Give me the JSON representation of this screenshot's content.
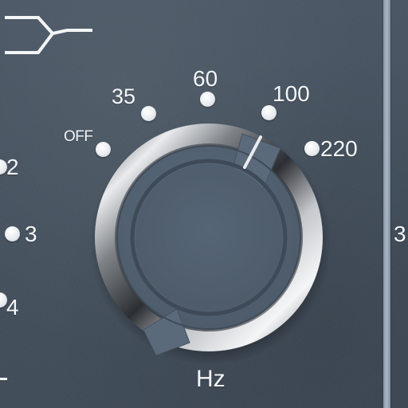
{
  "frequency_knob": {
    "unit_label": "Hz",
    "scale_labels": {
      "off": "OFF",
      "f35": "35",
      "f60": "60",
      "f100": "100",
      "f220": "220"
    },
    "selected_value": "100"
  },
  "left_selector": {
    "labels": [
      "2",
      "3",
      "4"
    ]
  },
  "right_edge_label": "3",
  "colors": {
    "panel_background": "#3e4b59",
    "marker_dots": "#eef0f2",
    "knob_cap": "#576778",
    "chrome_ring": "#b0b3b7"
  },
  "icons": {
    "top_left": "split-path-icon"
  }
}
